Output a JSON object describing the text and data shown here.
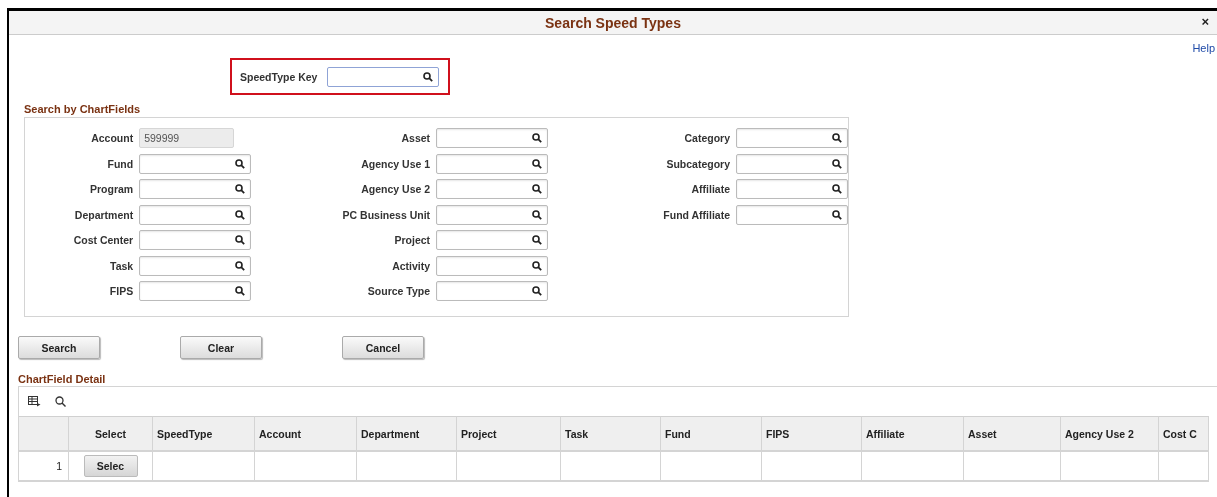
{
  "window": {
    "title": "Search Speed Types",
    "close": "×"
  },
  "help": "Help",
  "speedtype_key": {
    "label": "SpeedType Key"
  },
  "chartfields": {
    "title": "Search by ChartFields",
    "columns": [
      [
        {
          "label": "Account",
          "value": "599999",
          "disabled": true
        },
        {
          "label": "Fund",
          "disabled": false
        },
        {
          "label": "Program",
          "disabled": false
        },
        {
          "label": "Department",
          "disabled": false
        },
        {
          "label": "Cost Center",
          "disabled": false
        },
        {
          "label": "Task",
          "disabled": false
        },
        {
          "label": "FIPS",
          "disabled": false
        }
      ],
      [
        {
          "label": "Asset",
          "disabled": false
        },
        {
          "label": "Agency Use 1",
          "disabled": false
        },
        {
          "label": "Agency Use 2",
          "disabled": false
        },
        {
          "label": "PC Business Unit",
          "disabled": false
        },
        {
          "label": "Project",
          "disabled": false
        },
        {
          "label": "Activity",
          "disabled": false
        },
        {
          "label": "Source Type",
          "disabled": false
        }
      ],
      [
        {
          "label": "Category",
          "disabled": false
        },
        {
          "label": "Subcategory",
          "disabled": false
        },
        {
          "label": "Affiliate",
          "disabled": false
        },
        {
          "label": "Fund Affiliate",
          "disabled": false
        }
      ]
    ]
  },
  "buttons": [
    "Search",
    "Clear",
    "Cancel"
  ],
  "detail": {
    "title": "ChartField Detail",
    "columns": [
      "Select",
      "SpeedType",
      "Account",
      "Department",
      "Project",
      "Task",
      "Fund",
      "FIPS",
      "Affiliate",
      "Asset",
      "Agency Use 2",
      "Cost C"
    ],
    "rows": [
      {
        "number": "1",
        "select": "Selec"
      }
    ]
  }
}
